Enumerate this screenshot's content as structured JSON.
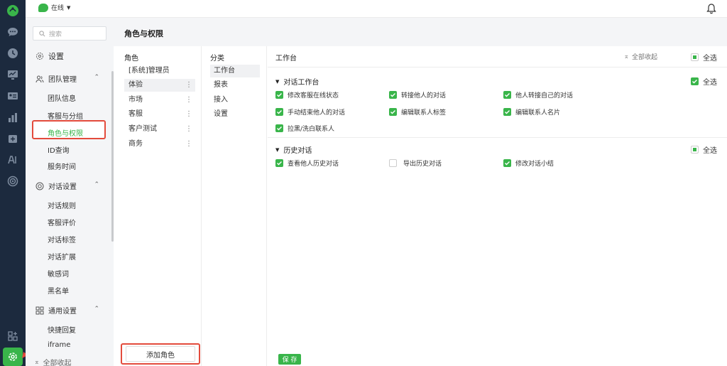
{
  "topbar": {
    "status_label": "在线"
  },
  "menu": {
    "search_placeholder": "搜索",
    "title": "设置",
    "groups": [
      {
        "label": "团队管理",
        "items": [
          "团队信息",
          "客服与分组",
          "角色与权限",
          "ID查询",
          "服务时间"
        ]
      },
      {
        "label": "对话设置",
        "items": [
          "对话规则",
          "客服评价",
          "对话标签",
          "对话扩展",
          "敏感词",
          "黑名单"
        ]
      },
      {
        "label": "通用设置",
        "items": [
          "快捷回复",
          "iframe"
        ]
      }
    ],
    "collapse_all": "全部收起"
  },
  "page": {
    "title": "角色与权限"
  },
  "roles": {
    "header": "角色",
    "items": [
      "[系统]管理员",
      "体验",
      "市场",
      "客服",
      "客户测试",
      "商务"
    ],
    "add_button": "添加角色"
  },
  "categories": {
    "header": "分类",
    "items": [
      "工作台",
      "报表",
      "接入",
      "设置"
    ]
  },
  "permissions": {
    "header": "工作台",
    "collapse_all": "全部收起",
    "select_all": "全选",
    "sections": [
      {
        "title": "对话工作台",
        "select_all": "全选",
        "options": [
          {
            "label": "修改客服在线状态",
            "checked": true
          },
          {
            "label": "转接他人的对话",
            "checked": true
          },
          {
            "label": "他人转接自己的对话",
            "checked": true
          },
          {
            "label": "手动结束他人的对话",
            "checked": true
          },
          {
            "label": "编辑联系人标签",
            "checked": true
          },
          {
            "label": "编辑联系人名片",
            "checked": true
          },
          {
            "label": "拉黑/洗白联系人",
            "checked": true
          }
        ]
      },
      {
        "title": "历史对话",
        "select_all": "全选",
        "options": [
          {
            "label": "查看他人历史对话",
            "checked": true
          },
          {
            "label": "导出历史对话",
            "checked": false
          },
          {
            "label": "修改对话小结",
            "checked": true
          }
        ]
      }
    ]
  },
  "footer": {
    "save_label": "保 存"
  },
  "colors": {
    "accent": "#39b54a",
    "rail": "#1c2a3e",
    "highlight": "#e34b3c"
  }
}
